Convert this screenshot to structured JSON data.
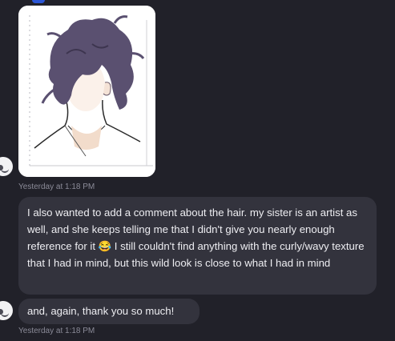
{
  "messages": [
    {
      "type": "image",
      "image_alt_icon": "sketch-image"
    },
    {
      "timestamp": "Yesterday at 1:18 PM"
    },
    {
      "type": "text",
      "text": "I also wanted to add a comment about the hair. my sister is an artist as well, and she keeps telling me that I didn't give you nearly enough reference for it 😂 I still couldn't find anything with the curly/wavy texture that I had in mind, but this wild look is close to what I had in mind"
    },
    {
      "type": "text",
      "text": "and, again, thank you so much!"
    },
    {
      "timestamp": "Yesterday at 1:18 PM"
    }
  ],
  "colors": {
    "background": "#212129",
    "bubble": "#33333d",
    "text": "#eeeef2",
    "timestamp": "#8b8b98"
  }
}
